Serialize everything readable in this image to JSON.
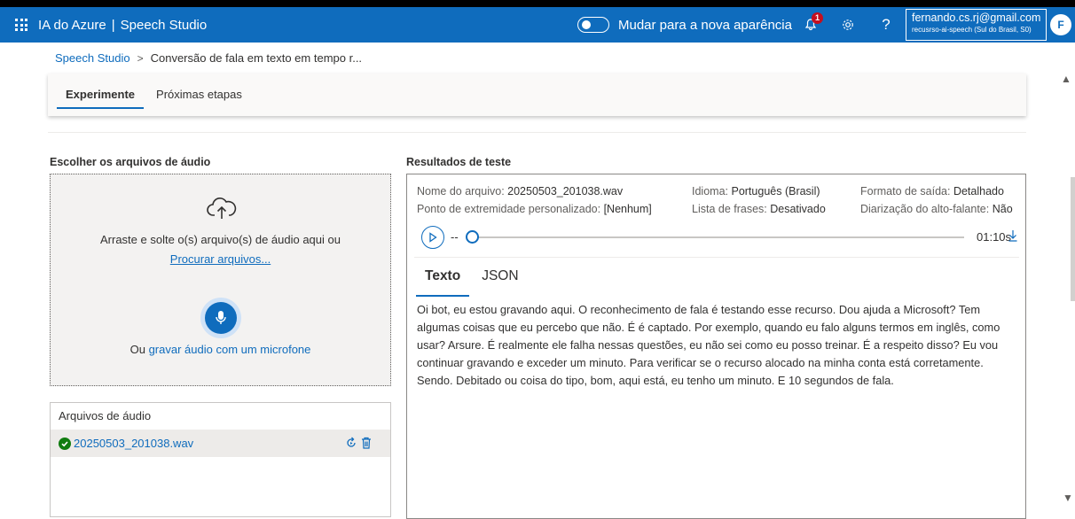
{
  "header": {
    "app_name": "IA do Azure",
    "separator": "|",
    "product": "Speech Studio",
    "toggle_label": "Mudar para a nova aparência",
    "notification_count": "1",
    "help_label": "?",
    "account_email": "fernando.cs.rj@gmail.com",
    "account_resource": "recusrso-ai-speech (Sul do Brasil, S0)",
    "avatar_initial": "F",
    "brand_color": "#0f6cbd"
  },
  "breadcrumb": {
    "root": "Speech Studio",
    "chevron": ">",
    "current": "Conversão de fala em texto em tempo r..."
  },
  "tabs": [
    {
      "label": "Experimente",
      "active": true
    },
    {
      "label": "Próximas etapas",
      "active": false
    }
  ],
  "upload": {
    "title": "Escolher os arquivos de áudio",
    "drag_text": "Arraste e solte o(s) arquivo(s) de áudio aqui ou",
    "browse_link": "Procurar arquivos...",
    "record_prefix": "Ou",
    "record_link": "gravar áudio com um microfone"
  },
  "files": {
    "title": "Arquivos de áudio",
    "items": [
      {
        "name": "20250503_201038.wav",
        "status": "success"
      }
    ]
  },
  "results": {
    "title": "Resultados de teste",
    "file_label": "Nome do arquivo:",
    "file_value": "20250503_201038.wav",
    "language_label": "Idioma:",
    "language_value": "Português (Brasil)",
    "format_label": "Formato de saída:",
    "format_value": "Detalhado",
    "endpoint_label": "Ponto de extremidade personalizado:",
    "endpoint_value": "[Nenhum]",
    "phrase_label": "Lista de frases:",
    "phrase_value": "Desativado",
    "diarization_label": "Diarização do alto-falante:",
    "diarization_value": "Não",
    "current_time": "--",
    "duration": "01:10s",
    "progress": 0,
    "tabs": [
      {
        "label": "Texto",
        "active": true
      },
      {
        "label": "JSON",
        "active": false
      }
    ],
    "transcript": "Oi bot, eu estou gravando aqui. O reconhecimento de fala é testando esse recurso. Dou ajuda a Microsoft? Tem algumas coisas que eu percebo que não. É é captado. Por exemplo, quando eu falo alguns termos em inglês, como usar? Arsure. É realmente ele falha nessas questões, eu não sei como eu posso treinar. É a respeito disso? Eu vou continuar gravando e exceder um minuto. Para verificar se o recurso alocado na minha conta está corretamente. Sendo. Debitado ou coisa do tipo, bom, aqui está, eu tenho um minuto. E 10 segundos de fala."
  }
}
